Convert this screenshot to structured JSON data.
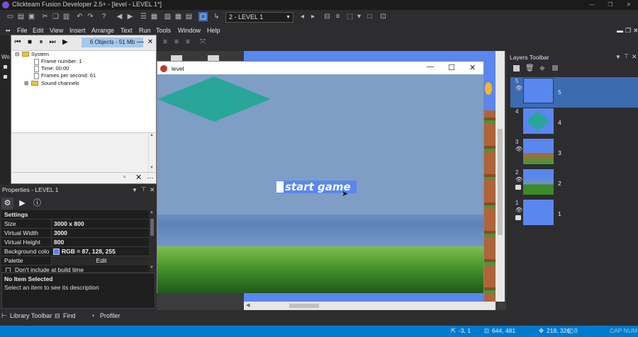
{
  "app": {
    "title": "Clickteam Fusion Developer 2.5+ - [level - LEVEL 1*]",
    "minimize": "—",
    "maximize": "❐",
    "close": "✕"
  },
  "toolbar": {
    "frame_select": "2 - LEVEL 1"
  },
  "menubar": [
    "File",
    "Edit",
    "View",
    "Insert",
    "Arrange",
    "Text",
    "Run",
    "Tools",
    "Window",
    "Help"
  ],
  "left_panel_stub": "Wo",
  "debugger": {
    "status": "6 Objects - 51 Mb",
    "tree": {
      "system": "System",
      "frame_number": "Frame number: 1",
      "time": "Time: 00:00",
      "fps": "Frames per second: 61",
      "sound_channels": "Sound channels"
    }
  },
  "level_window": {
    "title": "level",
    "start_text": "start game"
  },
  "properties": {
    "title": "Properties - LEVEL 1",
    "section": "Settings",
    "rows": [
      {
        "key": "Size",
        "value": "3000 x 800"
      },
      {
        "key": "Virtual Width",
        "value": "3000"
      },
      {
        "key": "Virtual Height",
        "value": "800"
      },
      {
        "key": "Background colo",
        "value": "RGB = 87, 128, 255"
      },
      {
        "key": "Palette",
        "value": "Edit"
      }
    ],
    "build_checkbox": "Don't include at build time",
    "desc_title": "No Item Selected",
    "desc_text": "Select an item to see its description"
  },
  "bottom_tabs": {
    "library": "Library Toolbar",
    "find": "Find",
    "profiler": "Profiler"
  },
  "layers": {
    "title": "Layers Toolbar",
    "items": [
      {
        "num": "5",
        "name": "5",
        "selected": true
      },
      {
        "num": "4",
        "name": "4",
        "selected": false
      },
      {
        "num": "3",
        "name": "3",
        "selected": false
      },
      {
        "num": "2",
        "name": "2",
        "selected": false
      },
      {
        "num": "1",
        "name": "1",
        "selected": false
      }
    ]
  },
  "statusbar": {
    "cursor": "-3, 1",
    "screen": "644, 481",
    "pos": "218, 326",
    "count": "0",
    "caps": "CAP  NUM"
  },
  "colors": {
    "accent": "#007acc",
    "background_rgb": "#5780ff",
    "selected_layer": "#3b6cb0"
  }
}
